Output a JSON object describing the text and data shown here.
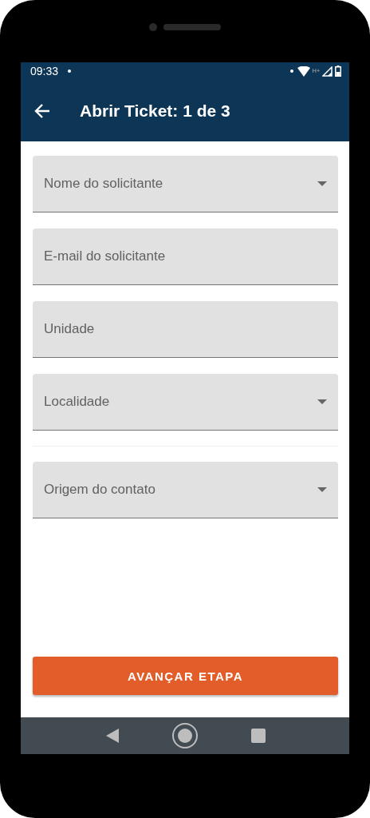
{
  "status_bar": {
    "time": "09:33",
    "network_type": "H+"
  },
  "app_bar": {
    "title": "Abrir Ticket: 1 de 3"
  },
  "fields": [
    {
      "kind": "dropdown",
      "placeholder": "Nome do solicitante"
    },
    {
      "kind": "text",
      "placeholder": "E-mail do solicitante"
    },
    {
      "kind": "text",
      "placeholder": "Unidade"
    },
    {
      "kind": "dropdown",
      "placeholder": "Localidade"
    },
    {
      "kind": "dropdown",
      "placeholder": "Origem do contato"
    }
  ],
  "button": {
    "label": "AVANÇAR ETAPA"
  }
}
